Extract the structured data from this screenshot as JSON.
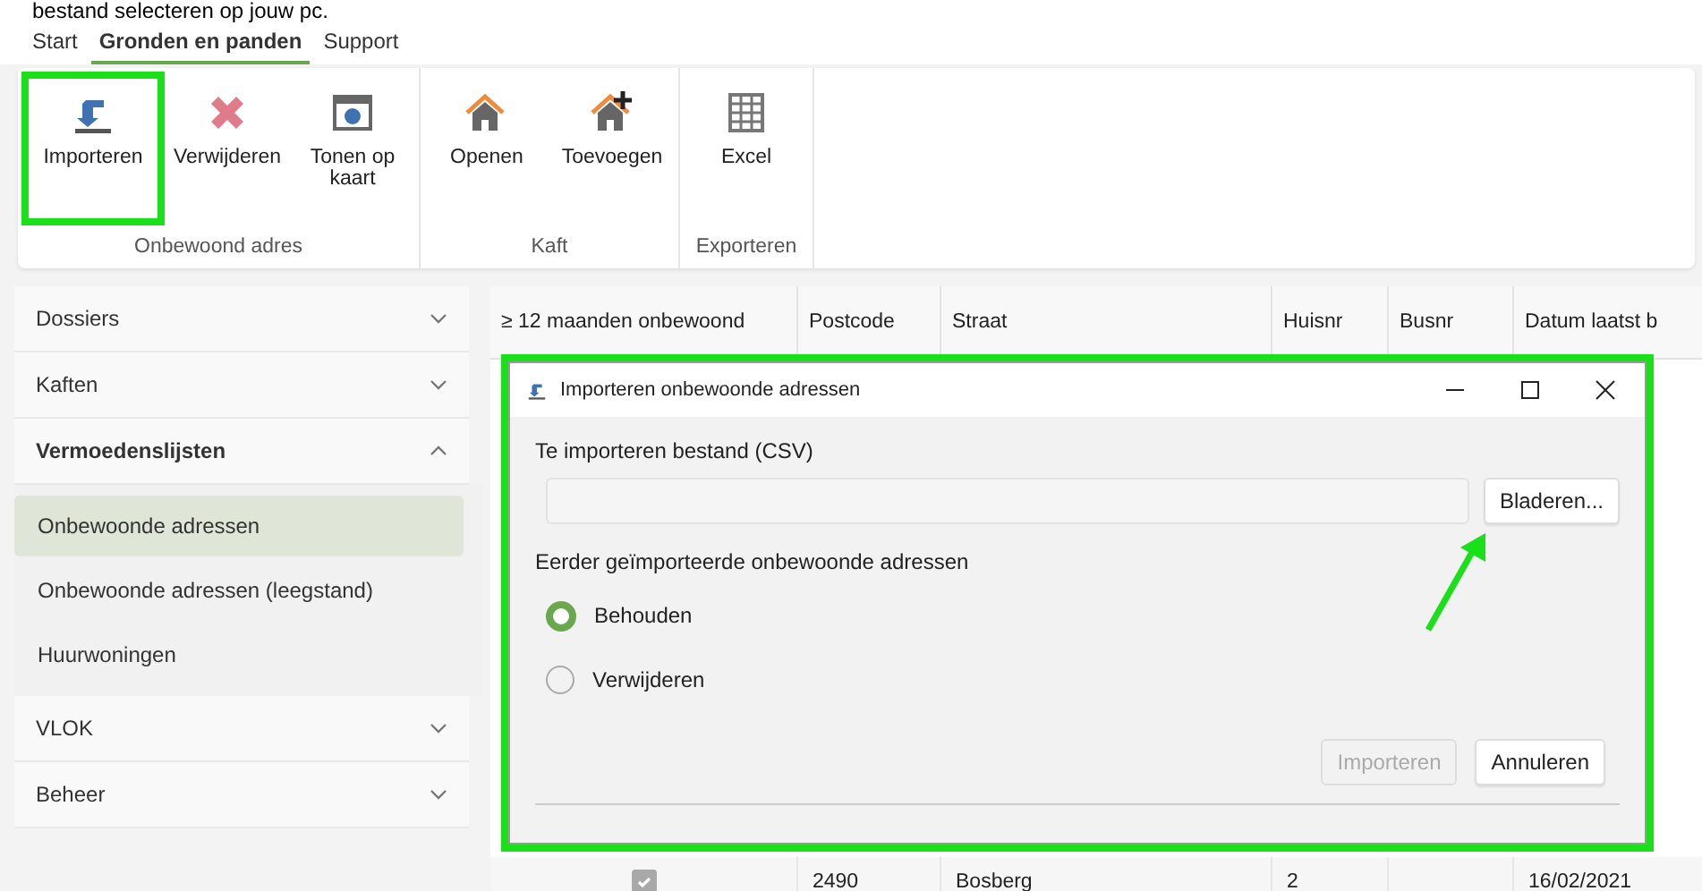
{
  "caption": "bestand selecteren op jouw pc.",
  "tabs": [
    {
      "label": "Start",
      "selected": false
    },
    {
      "label": "Gronden en panden",
      "selected": true
    },
    {
      "label": "Support",
      "selected": false
    }
  ],
  "ribbon_groups": [
    {
      "label": "Onbewoond adres",
      "buttons": [
        {
          "kind": "import",
          "label": "Importeren",
          "highlighted": true
        },
        {
          "kind": "delete",
          "label": "Verwijderen",
          "highlighted": false
        },
        {
          "kind": "map",
          "label": "Tonen op kaart",
          "highlighted": false
        }
      ]
    },
    {
      "label": "Kaft",
      "buttons": [
        {
          "kind": "house",
          "label": "Openen",
          "highlighted": false
        },
        {
          "kind": "house-add",
          "label": "Toevoegen",
          "highlighted": false
        }
      ]
    },
    {
      "label": "Exporteren",
      "buttons": [
        {
          "kind": "grid",
          "label": "Excel",
          "highlighted": false
        }
      ]
    }
  ],
  "sidebar": {
    "items": [
      {
        "label": "Dossiers",
        "expanded": false
      },
      {
        "label": "Kaften",
        "expanded": false
      },
      {
        "label": "Vermoedenslijsten",
        "expanded": true,
        "children": [
          {
            "label": "Onbewoonde adressen",
            "selected": true
          },
          {
            "label": "Onbewoonde adressen (leegstand)",
            "selected": false
          },
          {
            "label": "Huurwoningen",
            "selected": false
          }
        ]
      },
      {
        "label": "VLOK",
        "expanded": false
      },
      {
        "label": "Beheer",
        "expanded": false
      }
    ]
  },
  "table": {
    "columns": [
      "≥ 12 maanden onbewoond",
      "Postcode",
      "Straat",
      "Huisnr",
      "Busnr",
      "Datum laatst b"
    ],
    "rows": [
      {
        "checked": true,
        "cells": [
          "",
          "2490",
          "Bosberg",
          "2",
          "",
          "16/02/2021"
        ]
      }
    ]
  },
  "dialog": {
    "title": "Importeren onbewoonde adressen",
    "file_label": "Te importeren bestand (CSV)",
    "browse": "Bladeren...",
    "previous_label": "Eerder geïmporteerde onbewoonde adressen",
    "options": [
      {
        "label": "Behouden",
        "selected": true
      },
      {
        "label": "Verwijderen",
        "selected": false
      }
    ],
    "buttons": [
      {
        "label": "Importeren",
        "disabled": true
      },
      {
        "label": "Annuleren",
        "disabled": false
      }
    ]
  }
}
